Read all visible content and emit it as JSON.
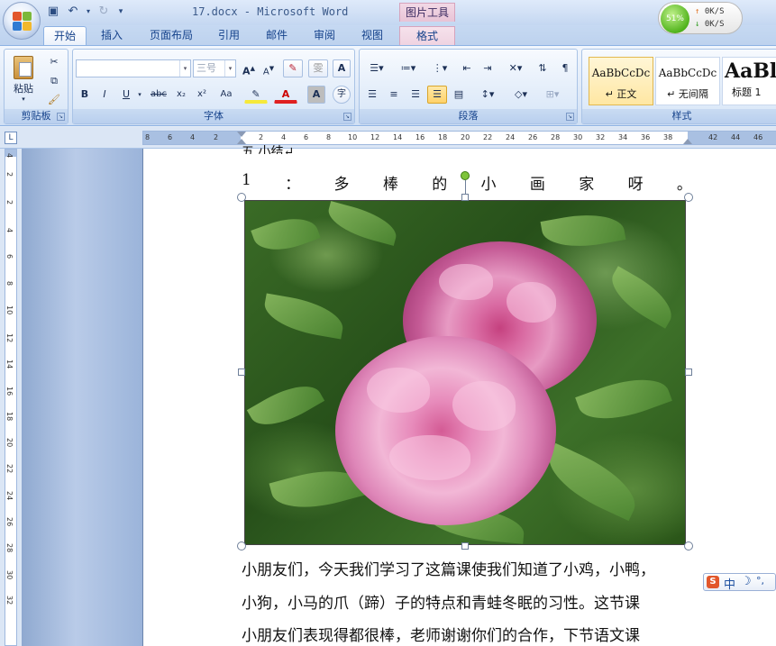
{
  "titlebar": {
    "title": "17.docx - Microsoft Word",
    "context_tool": "图片工具",
    "quick_access": [
      "save",
      "undo",
      "redo"
    ]
  },
  "speed_meter": {
    "percent": "51%",
    "up": "0K/S",
    "down": "0K/S"
  },
  "tabs": [
    "开始",
    "插入",
    "页面布局",
    "引用",
    "邮件",
    "审阅",
    "视图",
    "格式"
  ],
  "ribbon": {
    "clipboard": {
      "label": "剪贴板",
      "paste": "粘贴"
    },
    "font": {
      "label": "字体",
      "font_name": "",
      "font_size": "三号",
      "buttons": [
        "B",
        "I",
        "U",
        "abc",
        "x₂",
        "x²",
        "Aa",
        "A",
        "A",
        "字"
      ]
    },
    "paragraph": {
      "label": "段落"
    },
    "styles": {
      "label": "样式",
      "items": [
        {
          "sample": "AaBbCcDc",
          "name": "↵ 正文"
        },
        {
          "sample": "AaBbCcDc",
          "name": "↵ 无间隔"
        },
        {
          "sample": "AaBl",
          "name": "标题 1"
        }
      ]
    }
  },
  "ruler": {
    "corner": "L",
    "h_ticks": [
      "8",
      "6",
      "4",
      "2",
      "2",
      "4",
      "6",
      "8",
      "10",
      "12",
      "14",
      "16",
      "18",
      "20",
      "22",
      "24",
      "26",
      "28",
      "30",
      "32",
      "34",
      "36",
      "38",
      "40",
      "42",
      "44",
      "46"
    ],
    "v_ticks": [
      "4",
      "2",
      "2",
      "4",
      "6",
      "8",
      "10",
      "12",
      "14",
      "16",
      "18",
      "20",
      "22",
      "24",
      "26",
      "28",
      "30",
      "32"
    ]
  },
  "document": {
    "cut_line": "五.小结↵",
    "title_chars": [
      "1",
      "：",
      "多",
      "棒",
      "的",
      "小",
      "画",
      "家",
      "呀",
      "。"
    ],
    "lines": [
      "小朋友们，今天我们学习了这篇课使我们知道了小鸡，小鸭，",
      "小狗，小马的爪（蹄）子的特点和青蛙冬眠的习性。这节课",
      "小朋友们表现得都很棒，老师谢谢你们的合作，下节语文课"
    ]
  },
  "ime": {
    "logo": "S",
    "mode": "中",
    "moon": "☽",
    "punct": "°,"
  }
}
